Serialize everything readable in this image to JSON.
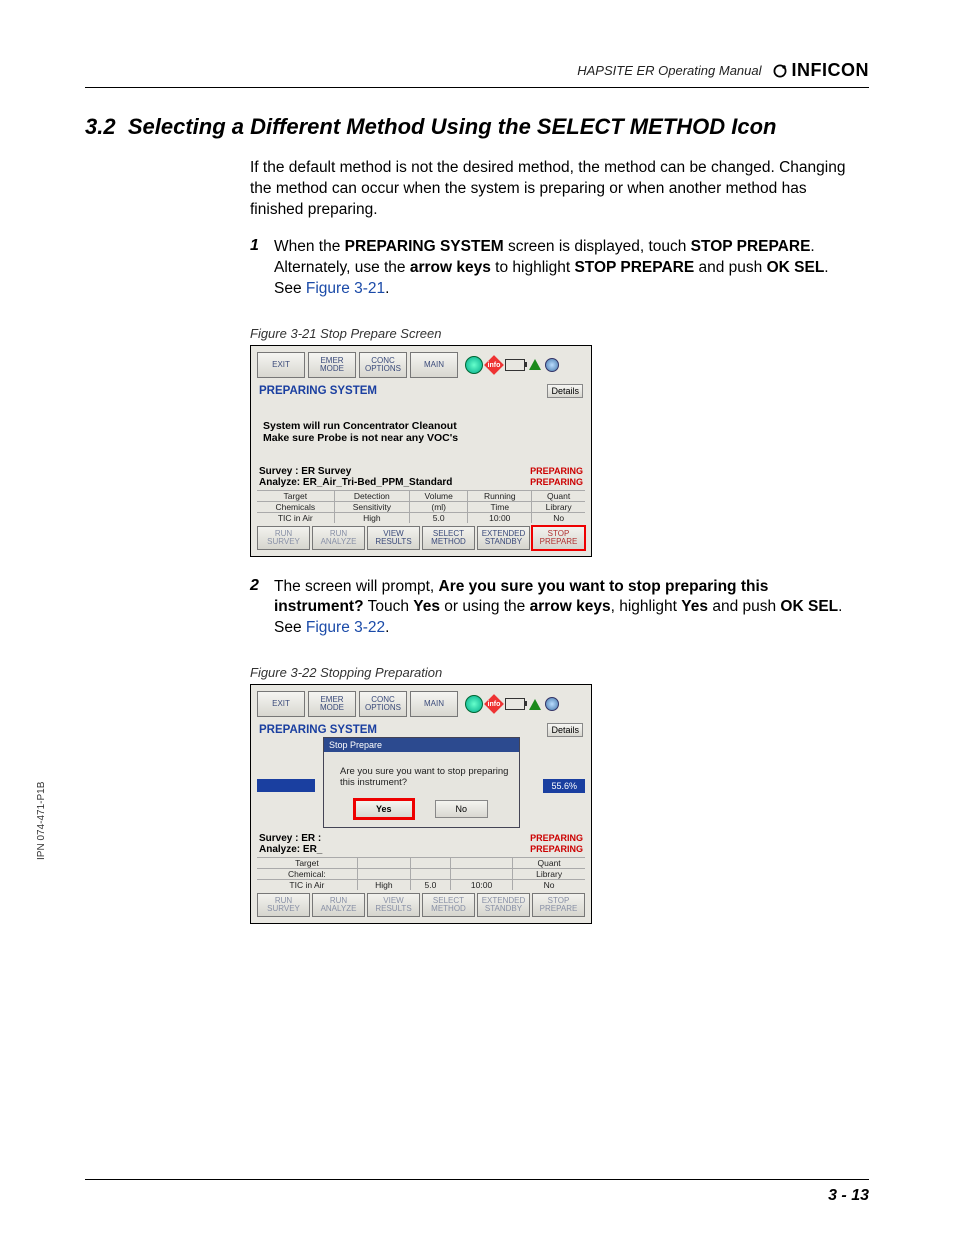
{
  "header": {
    "manual_title": "HAPSITE ER Operating Manual",
    "brand": "INFICON"
  },
  "section": {
    "number": "3.2",
    "title": "Selecting a Different Method Using the SELECT METHOD Icon"
  },
  "intro": "If the default method is not the desired method, the method can be changed. Changing the method can occur when the system is preparing or when another method has finished preparing.",
  "step1": {
    "num": "1",
    "t1": "When the ",
    "b1": "PREPARING SYSTEM",
    "t2": " screen is displayed, touch ",
    "b2": "STOP PREPARE",
    "t3": ". Alternately, use the ",
    "b3": "arrow keys",
    "t4": " to highlight ",
    "b4": "STOP PREPARE",
    "t5": " and push ",
    "b5": "OK SEL",
    "t6": ". See ",
    "link": "Figure 3-21",
    "t7": "."
  },
  "fig1": {
    "caption": "Figure 3-21  Stop Prepare Screen"
  },
  "step2": {
    "num": "2",
    "t1": "The screen will prompt, ",
    "b1": "Are you sure you want to stop preparing this instrument?",
    "t2": " Touch ",
    "b2": "Yes",
    "t3": " or using the ",
    "b3": "arrow keys",
    "t4": ", highlight ",
    "b4": "Yes",
    "t5": " and push ",
    "b5": "OK SEL",
    "t6": ". See ",
    "link": "Figure 3-22",
    "t7": "."
  },
  "fig2": {
    "caption": "Figure 3-22  Stopping Preparation"
  },
  "screen": {
    "top": {
      "exit": "EXIT",
      "emer": "EMER\nMODE",
      "conc": "CONC\nOPTIONS",
      "main": "MAIN"
    },
    "sys_title": "PREPARING SYSTEM",
    "details": "Details",
    "msg_l1": "System will run Concentrator Cleanout",
    "msg_l2": "Make sure Probe is not near any VOC's",
    "survey": "Survey : ER Survey",
    "survey_short": "Survey : ER :",
    "analyze": "Analyze: ER_Air_Tri-Bed_PPM_Standard",
    "analyze_short": "Analyze: ER_",
    "preparing": "PREPARING",
    "cols": {
      "h1": "Target",
      "h2": "Detection",
      "h3": "Volume",
      "h4": "Running",
      "h5": "Quant",
      "r1": "Chemicals",
      "r2": "Sensitivity",
      "r3": "(ml)",
      "r4": "Time",
      "r5": "Library",
      "v1": "TIC in Air",
      "v2": "High",
      "v3": "5.0",
      "v4": "10:00",
      "v5": "No"
    },
    "cols2": {
      "h1": "Target",
      "h5": "Quant",
      "r1": "Chemical:",
      "r5": "Library",
      "v1": "TIC in Air"
    },
    "bot": {
      "run_survey": "RUN\nSURVEY",
      "run_analyze": "RUN\nANALYZE",
      "view_results": "VIEW\nRESULTS",
      "select_method": "SELECT\nMETHOD",
      "ext_standby": "EXTENDED\nSTANDBY",
      "stop_prepare": "STOP\nPREPARE"
    },
    "dialog": {
      "title": "Stop Prepare",
      "msg": "Are you sure you want to stop preparing this instrument?",
      "yes": "Yes",
      "no": "No",
      "pct": "55.6%"
    }
  },
  "side": "IPN 074-471-P1B",
  "footer": "3 - 13"
}
